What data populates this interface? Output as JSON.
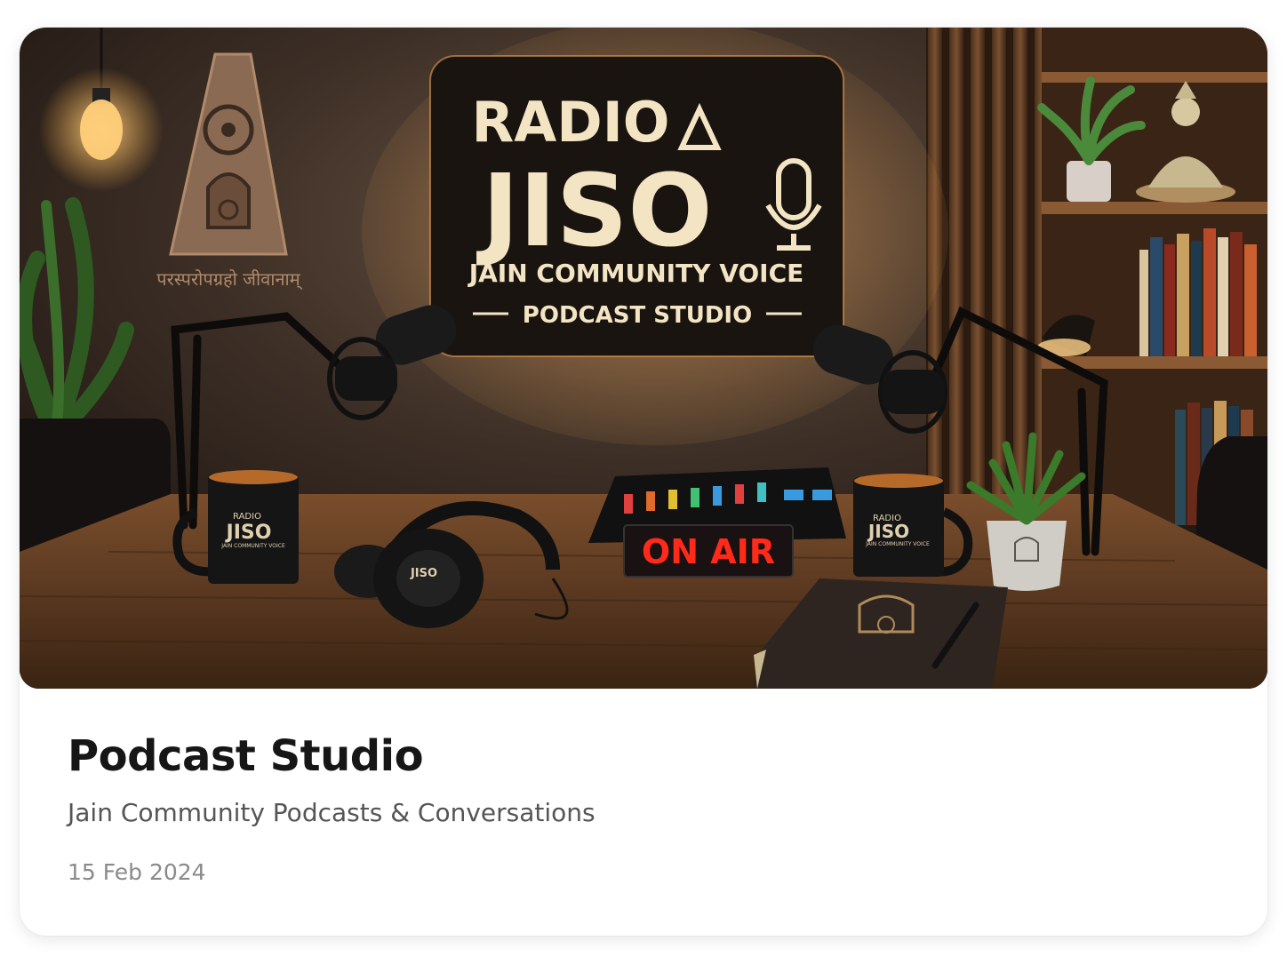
{
  "card": {
    "title": "Podcast Studio",
    "subtitle": "Jain Community Podcasts & Conversations",
    "date": "15 Feb 2024"
  },
  "hero": {
    "sign": {
      "line1": "RADIO",
      "line2": "JISO",
      "line3": "JAIN COMMUNITY VOICE",
      "line4": "PODCAST STUDIO"
    },
    "on_air": "ON AIR",
    "mug_label_top": "RADIO",
    "mug_label_main": "JISO",
    "mug_label_bottom": "JAIN COMMUNITY VOICE",
    "headphone_label": "JISO",
    "wall_caption": "परस्परोपग्रहो जीवानाम्"
  },
  "colors": {
    "sign_text": "#f3e4c4",
    "sign_glow": "#e8a050",
    "on_air_red": "#ff2a1a",
    "title": "#161616",
    "subtitle": "#555555",
    "date": "#8a8a8a"
  }
}
